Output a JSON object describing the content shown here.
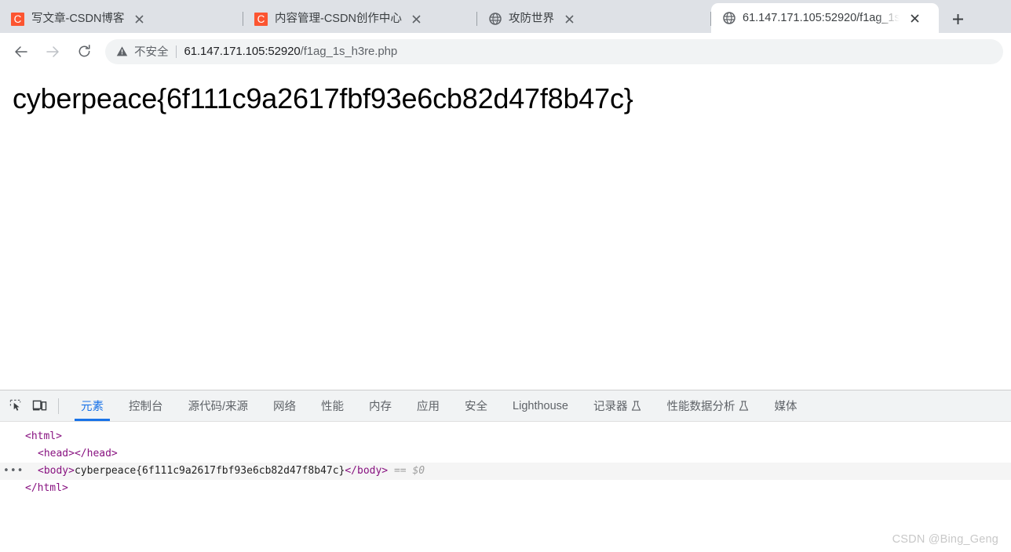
{
  "browser": {
    "tabs": [
      {
        "title": "写文章-CSDN博客",
        "favicon": "csdn-logo-icon",
        "active": false,
        "close_label": "×"
      },
      {
        "title": "内容管理-CSDN创作中心",
        "favicon": "csdn-logo-icon",
        "active": false,
        "close_label": "×"
      },
      {
        "title": "攻防世界",
        "favicon": "globe-icon",
        "active": false,
        "close_label": "×"
      },
      {
        "title": "61.147.171.105:52920/f1ag_1s",
        "favicon": "globe-icon",
        "active": true,
        "close_label": "×"
      }
    ],
    "new_tab_label": "+",
    "toolbar": {
      "back_icon": "arrow-left-icon",
      "forward_icon": "arrow-right-icon",
      "reload_icon": "reload-icon",
      "security_icon": "warning-triangle-icon",
      "security_label": "不安全",
      "url_host": "61.147.171.105:52920",
      "url_path": "/f1ag_1s_h3re.php",
      "url_full": "61.147.171.105:52920/f1ag_1s_h3re.php"
    }
  },
  "page": {
    "body_text": "cyberpeace{6f111c9a2617fbf93e6cb82d47f8b47c}"
  },
  "devtools": {
    "inspect_icon": "inspect-element-icon",
    "device_icon": "device-toolbar-icon",
    "tabs": [
      {
        "label": "元素",
        "active": true,
        "icon": null
      },
      {
        "label": "控制台",
        "active": false,
        "icon": null
      },
      {
        "label": "源代码/来源",
        "active": false,
        "icon": null
      },
      {
        "label": "网络",
        "active": false,
        "icon": null
      },
      {
        "label": "性能",
        "active": false,
        "icon": null
      },
      {
        "label": "内存",
        "active": false,
        "icon": null
      },
      {
        "label": "应用",
        "active": false,
        "icon": null
      },
      {
        "label": "安全",
        "active": false,
        "icon": null
      },
      {
        "label": "Lighthouse",
        "active": false,
        "icon": null
      },
      {
        "label": "记录器",
        "active": false,
        "icon": "flask-icon"
      },
      {
        "label": "性能数据分析",
        "active": false,
        "icon": "flask-icon"
      },
      {
        "label": "媒体",
        "active": false,
        "icon": null
      }
    ],
    "dom": {
      "line1": "<html>",
      "line2": "<head></head>",
      "line3_open": "<body>",
      "line3_text": "cyberpeace{6f111c9a2617fbf93e6cb82d47f8b47c}",
      "line3_close": "</body>",
      "line3_marker": "== $0",
      "line3_dots": "•••",
      "line4": "</html>"
    }
  },
  "watermark": {
    "text": "CSDN @Bing_Geng"
  },
  "colors": {
    "accent": "#1a73e8",
    "tabstrip_bg": "#dee1e6",
    "csdn_orange": "#fc5531",
    "devtools_header_bg": "#f1f3f4",
    "tag_color": "#881280"
  }
}
